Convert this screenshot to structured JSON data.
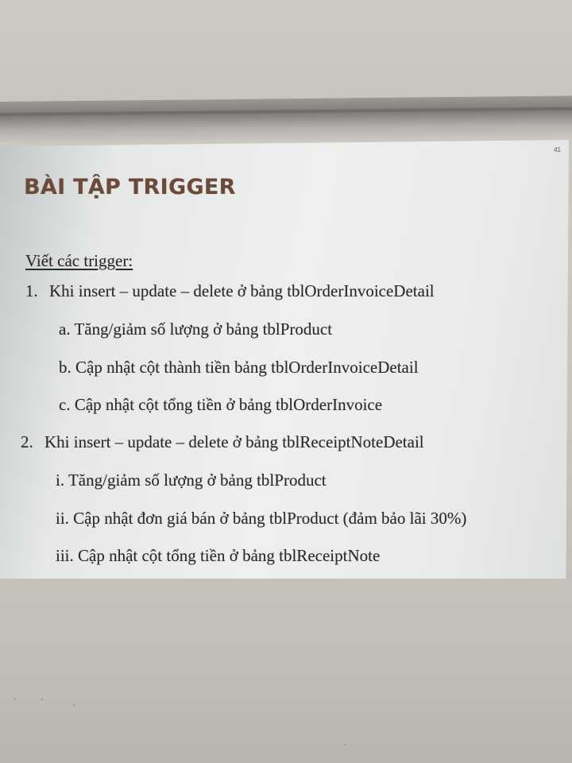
{
  "slide": {
    "page_number": "41",
    "title": "BÀI TẬP TRIGGER",
    "intro": "Viết các trigger:",
    "items": [
      {
        "number": "1.",
        "text": "Khi insert – update – delete ở bảng tblOrderInvoiceDetail",
        "subitems": [
          "a. Tăng/giảm số lượng ở bảng tblProduct",
          "b. Cập nhật cột thành tiền bảng tblOrderInvoiceDetail",
          "c. Cập nhật cột tổng tiền ở bảng tblOrderInvoice"
        ]
      },
      {
        "number": "2.",
        "text": "Khi insert – update – delete ở bảng tblReceiptNoteDetail",
        "subitems": [
          "i. Tăng/giảm số lượng ở bảng tblProduct",
          "ii. Cập nhật đơn giá bán ở bảng tblProduct (đảm bảo lãi 30%)",
          "iii. Cập nhật cột tổng tiền ở bảng tblReceiptNote"
        ]
      }
    ]
  },
  "colors": {
    "title": "#6b4a3a",
    "body_text": "#2b2b2e",
    "slide_bg": "#eef0ef",
    "wall": "#c8c3bc"
  }
}
